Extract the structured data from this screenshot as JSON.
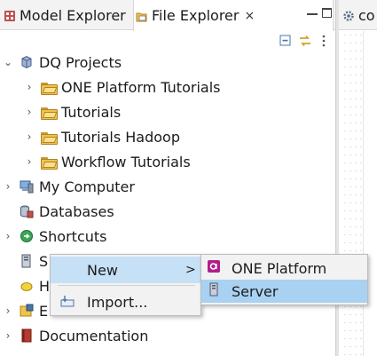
{
  "tabs": [
    {
      "label": "Model Explorer",
      "icon": "model-explorer-icon",
      "active": false
    },
    {
      "label": "File Explorer",
      "icon": "file-explorer-icon",
      "active": true,
      "close": "×"
    },
    {
      "label": "co",
      "icon": "gear-icon",
      "active": false
    }
  ],
  "view_toolbar": [
    "collapse-all-icon",
    "link-with-editor-icon",
    "view-menu-icon"
  ],
  "tree": {
    "root": {
      "label": "DQ Projects",
      "icon": "project-icon",
      "expanded": true
    },
    "projects": [
      {
        "label": "ONE Platform Tutorials",
        "icon": "folder-icon"
      },
      {
        "label": "Tutorials",
        "icon": "folder-icon"
      },
      {
        "label": "Tutorials Hadoop",
        "icon": "folder-icon"
      },
      {
        "label": "Workflow Tutorials",
        "icon": "folder-icon"
      }
    ],
    "my_computer": "My Computer",
    "databases": "Databases",
    "shortcuts": "Shortcuts",
    "servers_partial": "S",
    "h_partial": "H",
    "e_partial": "E",
    "documentation": "Documentation"
  },
  "context_menu": {
    "items": [
      {
        "label": "New",
        "has_submenu": true,
        "arrow": ">",
        "highlighted": true
      },
      {
        "label": "Import...",
        "icon": "import-icon",
        "highlighted": false
      }
    ]
  },
  "submenu": {
    "items": [
      {
        "label": "ONE Platform",
        "icon": "one-platform-icon",
        "highlighted": false
      },
      {
        "label": "Server",
        "icon": "server-icon",
        "highlighted": true
      }
    ]
  },
  "colors": {
    "menu_highlight": "#c6e0f6",
    "submenu_highlight": "#a8d1f2",
    "one_platform_accent": "#b01f8c"
  }
}
